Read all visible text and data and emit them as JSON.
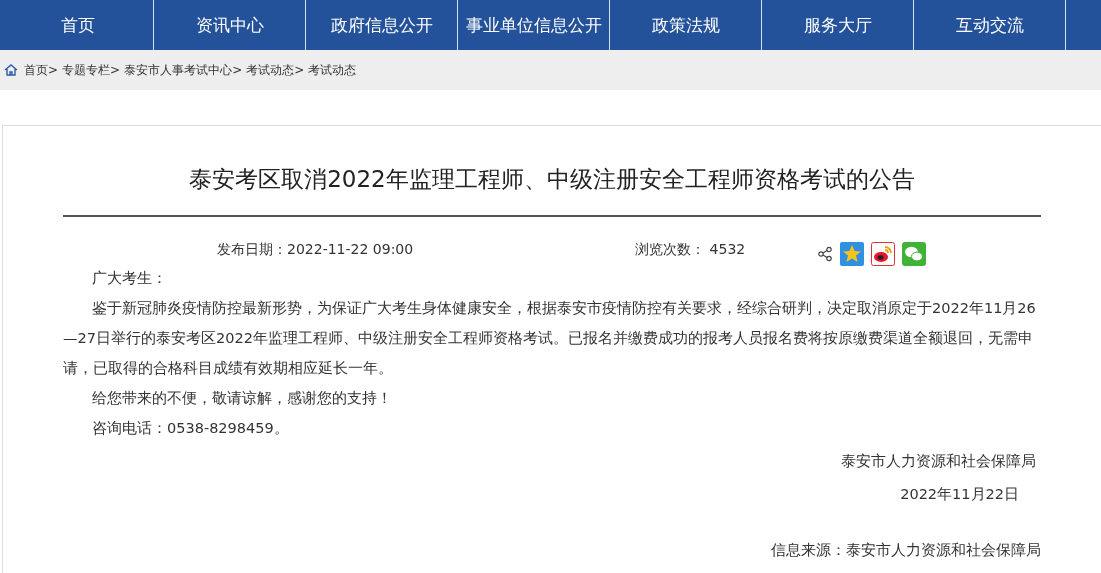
{
  "nav": [
    {
      "label": "首页",
      "selected": false
    },
    {
      "label": "资讯中心",
      "selected": false
    },
    {
      "label": "政府信息公开",
      "selected": false
    },
    {
      "label": "事业单位信息公开",
      "selected": false
    },
    {
      "label": "政策法规",
      "selected": false
    },
    {
      "label": "服务大厅",
      "selected": false
    },
    {
      "label": "互动交流",
      "selected": false
    }
  ],
  "breadcrumb": [
    "首页>",
    "专题专栏>",
    "泰安市人事考试中心>",
    "考试动态>",
    "考试动态"
  ],
  "article": {
    "title": "泰安考区取消2022年监理工程师、中级注册安全工程师资格考试的公告",
    "published": "发布日期：2022-11-22 09:00",
    "views": "浏览次数： 4532",
    "greeting": "广大考生：",
    "paragraphs": [
      "鉴于新冠肺炎疫情防控最新形势，为保证广大考生身体健康安全，根据泰安市疫情防控有关要求，经综合研判，决定取消原定于2022年11月26—27日举行的泰安考区2022年监理工程师、中级注册安全工程师资格考试。已报名并缴费成功的报考人员报名费将按原缴费渠道全额退回，无需申请，已取得的合格科目成绩有效期相应延长一年。",
      "给您带来的不便，敬请谅解，感谢您的支持！",
      "咨询电话：0538-8298459。"
    ],
    "signature": "泰安市人力资源和社会保障局",
    "date": "2022年11月22日",
    "source": "信息来源：泰安市人力资源和社会保障局"
  }
}
